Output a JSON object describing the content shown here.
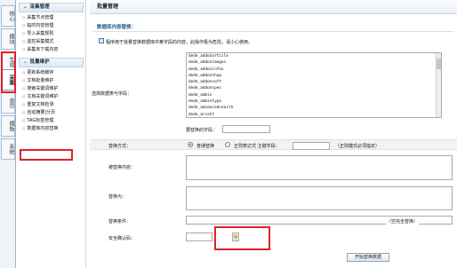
{
  "vtabs": [
    {
      "label": "核心"
    },
    {
      "label": "模块"
    },
    {
      "label": "生成"
    },
    {
      "label": "采集"
    },
    {
      "label": "会员"
    },
    {
      "label": "模板"
    },
    {
      "label": "系统"
    }
  ],
  "sidebar": {
    "group1": {
      "title": "采集管理",
      "items": [
        {
          "label": "采集节点管理"
        },
        {
          "label": "临时内容管理"
        },
        {
          "label": "导入采集规则"
        },
        {
          "label": "监控采集模式"
        },
        {
          "label": "采集未下载内容"
        }
      ]
    },
    "group2": {
      "title": "批量维护",
      "items": [
        {
          "label": "更新系统缓存"
        },
        {
          "label": "文档批量维护"
        },
        {
          "label": "搜索关键词维护"
        },
        {
          "label": "文档关键词维护"
        },
        {
          "label": "重复文档检测"
        },
        {
          "label": "自动摘要|分页"
        },
        {
          "label": "TAG标签管理"
        },
        {
          "label": "数据库内容替换"
        }
      ]
    }
  },
  "main": {
    "header_title": "批量管理",
    "section_title": "数据库内容替换：",
    "notice": "程序用于批量替换数据库中某字段的内容，此操作极为危险，请小心使用。",
    "tables_label": "选择数据表与字段：",
    "tables": [
      "dede_addonarticle",
      "dede_addonimages",
      "dede_addoninfos",
      "dede_addonshop",
      "dede_addonsoft",
      "dede_addonspec",
      "dede_admin",
      "dede_admintype",
      "dede_advancedsearch",
      "dede_arcatt"
    ],
    "field_label": "要替换的字段：",
    "mode_label": "替换方式：",
    "mode_normal": "普通替换",
    "mode_regex": "正则表达式 主键字段：",
    "mode_regex_note": "（正则模式必须指定）",
    "replace_content_label": "被替换内容：",
    "replace_with_label": "替换为：",
    "condition_label": "替换条件：",
    "condition_note": "（空完全替换）",
    "captcha_label": "安全确认码：",
    "captcha_glyph": "◎",
    "start_button": "开始替换数据"
  }
}
